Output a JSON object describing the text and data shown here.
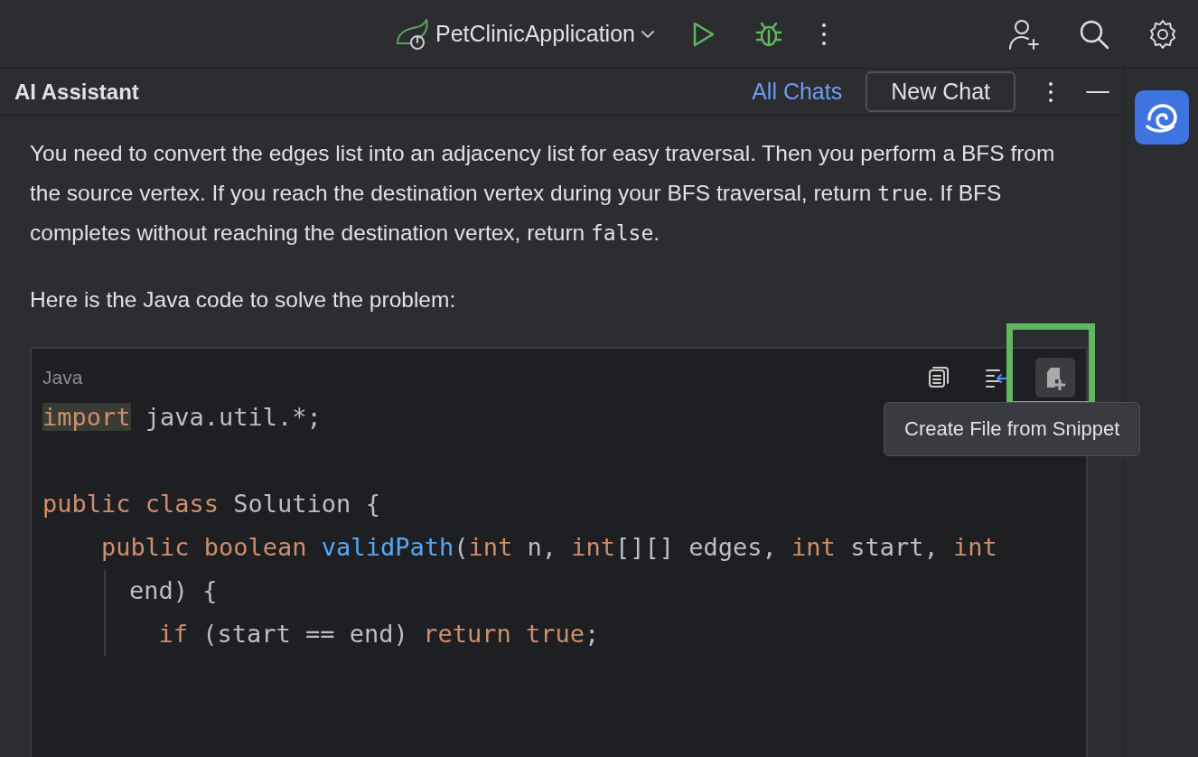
{
  "toolbar": {
    "run_configuration": "PetClinicApplication"
  },
  "panel": {
    "title": "AI Assistant",
    "all_chats": "All Chats",
    "new_chat": "New Chat"
  },
  "message": {
    "paragraphs": [
      [
        {
          "text": "You need to convert the edges list into an adjacency list for easy traversal. Then you perform a BFS from the source vertex. If you reach the destination vertex during your BFS traversal, return ",
          "kind": "prose"
        },
        {
          "text": "true",
          "kind": "code"
        },
        {
          "text": ". If BFS completes without reaching the destination vertex, return ",
          "kind": "prose"
        },
        {
          "text": "false",
          "kind": "code"
        },
        {
          "text": ".",
          "kind": "prose"
        }
      ],
      [
        {
          "text": "Here is the Java code to solve the problem:",
          "kind": "prose"
        }
      ]
    ]
  },
  "code_block": {
    "language": "Java",
    "actions": [
      {
        "kind": "copy",
        "highlighted": false
      },
      {
        "kind": "insert",
        "highlighted": false
      },
      {
        "kind": "create-file",
        "highlighted": true
      }
    ],
    "tooltip": "Create File from Snippet",
    "lines": [
      {
        "kind": "code",
        "tokens": [
          {
            "text": "import",
            "kind": "keyword",
            "highlighted": true
          },
          {
            "text": " java.util.*;",
            "kind": "plain",
            "highlighted": false
          }
        ]
      },
      {
        "kind": "blank"
      },
      {
        "kind": "code",
        "tokens": [
          {
            "text": "public class",
            "kind": "keyword",
            "highlighted": false
          },
          {
            "text": " Solution {",
            "kind": "plain",
            "highlighted": false
          }
        ]
      },
      {
        "kind": "code",
        "tokens": [
          {
            "text": "    public boolean ",
            "kind": "keyword",
            "highlighted": false
          },
          {
            "text": "validPath",
            "kind": "function",
            "highlighted": false
          },
          {
            "text": "(",
            "kind": "plain",
            "highlighted": false
          },
          {
            "text": "int",
            "kind": "keyword",
            "highlighted": false
          },
          {
            "text": " n, ",
            "kind": "plain",
            "highlighted": false
          },
          {
            "text": "int",
            "kind": "keyword",
            "highlighted": false
          },
          {
            "text": "[][] edges, ",
            "kind": "plain",
            "highlighted": false
          },
          {
            "text": "int",
            "kind": "keyword",
            "highlighted": false
          },
          {
            "text": " start, ",
            "kind": "plain",
            "highlighted": false
          },
          {
            "text": "int",
            "kind": "keyword",
            "highlighted": false
          }
        ]
      },
      {
        "kind": "wrap",
        "tokens": [
          {
            "text": "end) {",
            "kind": "plain",
            "highlighted": false
          }
        ]
      },
      {
        "kind": "wrap",
        "tokens": [
          {
            "text": "  if",
            "kind": "keyword",
            "highlighted": false
          },
          {
            "text": " (start == end) ",
            "kind": "plain",
            "highlighted": false
          },
          {
            "text": "return true",
            "kind": "keyword",
            "highlighted": false
          },
          {
            "text": ";",
            "kind": "plain",
            "highlighted": false
          }
        ]
      }
    ]
  }
}
